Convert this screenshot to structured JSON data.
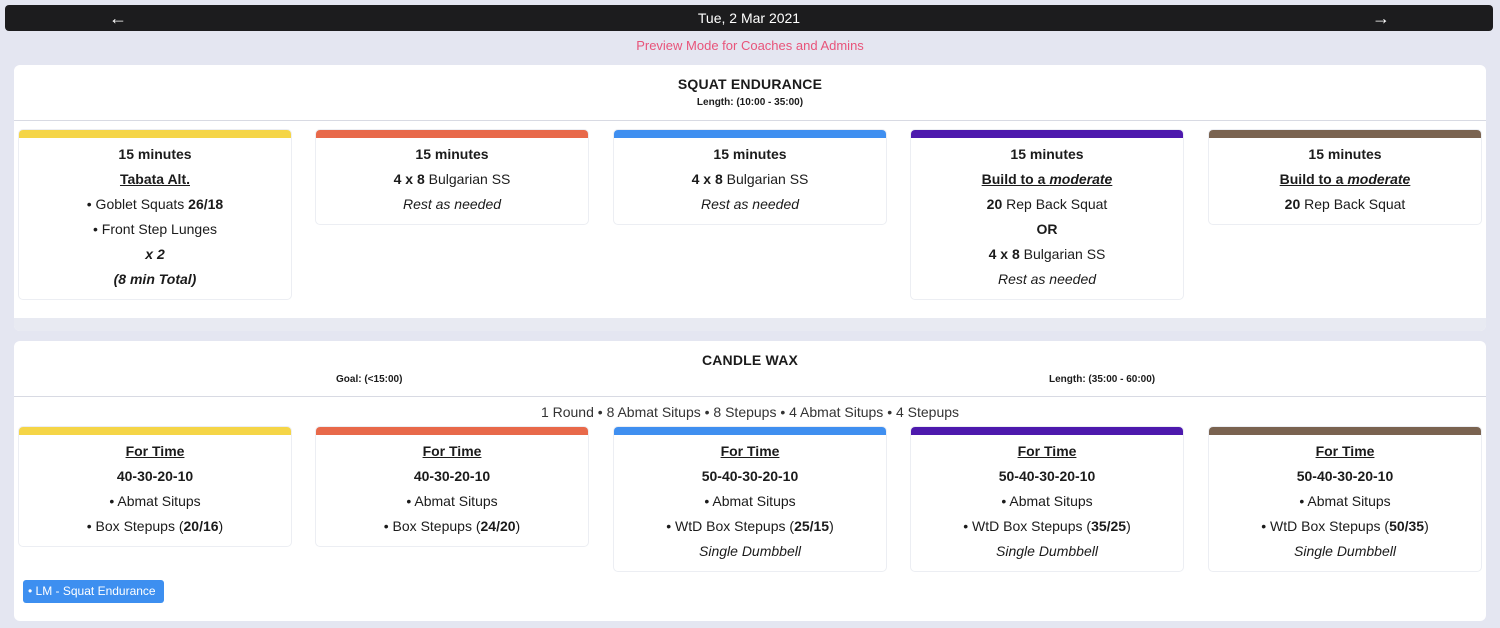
{
  "header": {
    "date": "Tue, 2 Mar 2021",
    "prev_icon": "←",
    "next_icon": "→"
  },
  "preview_notice": "Preview Mode for Coaches and Admins",
  "colors": {
    "accent": "#e8547a",
    "tracks": [
      "#f5d547",
      "#e8694a",
      "#3f8ff0",
      "#4d19ad",
      "#7a6350"
    ],
    "tag": "#3d8ff0"
  },
  "sections": [
    {
      "title": "SQUAT ENDURANCE",
      "length": "Length: (10:00 - 35:00)",
      "cards": [
        [
          [
            {
              "t": "15 minutes",
              "b": true
            }
          ],
          [
            {
              "t": "Tabata Alt.",
              "b": true,
              "u": true
            }
          ],
          [
            {
              "t": "• Goblet Squats "
            },
            {
              "t": "26/18",
              "b": true
            }
          ],
          [
            {
              "t": "• Front Step Lunges"
            }
          ],
          [
            {
              "t": "x 2",
              "b": true,
              "i": true
            }
          ],
          [
            {
              "t": "(8 min Total)",
              "b": true,
              "i": true
            }
          ]
        ],
        [
          [
            {
              "t": "15 minutes",
              "b": true
            }
          ],
          [
            {
              "t": "4 x 8",
              "b": true
            },
            {
              "t": " Bulgarian SS"
            }
          ],
          [
            {
              "t": "Rest as needed",
              "i": true
            }
          ]
        ],
        [
          [
            {
              "t": "15 minutes",
              "b": true
            }
          ],
          [
            {
              "t": "4 x 8",
              "b": true
            },
            {
              "t": " Bulgarian SS"
            }
          ],
          [
            {
              "t": "Rest as needed",
              "i": true
            }
          ]
        ],
        [
          [
            {
              "t": "15 minutes",
              "b": true
            }
          ],
          [
            {
              "t": "Build to a ",
              "b": true,
              "u": true
            },
            {
              "t": "moderate",
              "b": true,
              "u": true,
              "i": true
            },
            {
              "t": " ",
              "b": true,
              "u": true
            }
          ],
          [
            {
              "t": "20",
              "b": true
            },
            {
              "t": " Rep Back Squat"
            }
          ],
          [
            {
              "t": "OR",
              "b": true
            }
          ],
          [
            {
              "t": "4 x 8",
              "b": true
            },
            {
              "t": " Bulgarian SS"
            }
          ],
          [
            {
              "t": "Rest as needed",
              "i": true
            }
          ]
        ],
        [
          [
            {
              "t": "15 minutes",
              "b": true
            }
          ],
          [
            {
              "t": "Build to a ",
              "b": true,
              "u": true
            },
            {
              "t": "moderate",
              "b": true,
              "u": true,
              "i": true
            },
            {
              "t": " ",
              "b": true,
              "u": true
            }
          ],
          [
            {
              "t": "20",
              "b": true
            },
            {
              "t": " Rep Back Squat"
            }
          ]
        ]
      ]
    },
    {
      "title": "CANDLE WAX",
      "goal": "Goal: (<15:00)",
      "length": "Length: (35:00 - 60:00)",
      "description": "1 Round • 8 Abmat Situps • 8 Stepups • 4 Abmat Situps • 4 Stepups",
      "cards": [
        [
          [
            {
              "t": "For Time",
              "b": true,
              "u": true
            }
          ],
          [
            {
              "t": "40-30-20-10",
              "b": true
            }
          ],
          [
            {
              "t": "• Abmat Situps"
            }
          ],
          [
            {
              "t": "• Box Stepups ("
            },
            {
              "t": "20/16",
              "b": true
            },
            {
              "t": ")"
            }
          ]
        ],
        [
          [
            {
              "t": "For Time",
              "b": true,
              "u": true
            }
          ],
          [
            {
              "t": "40-30-20-10",
              "b": true
            }
          ],
          [
            {
              "t": "• Abmat Situps"
            }
          ],
          [
            {
              "t": "• Box Stepups ("
            },
            {
              "t": "24/20",
              "b": true
            },
            {
              "t": ")"
            }
          ]
        ],
        [
          [
            {
              "t": "For Time",
              "b": true,
              "u": true
            }
          ],
          [
            {
              "t": "50-40-30-20-10",
              "b": true
            }
          ],
          [
            {
              "t": "• Abmat Situps"
            }
          ],
          [
            {
              "t": "• WtD Box Stepups ("
            },
            {
              "t": "25/15",
              "b": true
            },
            {
              "t": ")"
            }
          ],
          [
            {
              "t": "Single Dumbbell",
              "i": true
            }
          ]
        ],
        [
          [
            {
              "t": "For Time",
              "b": true,
              "u": true
            }
          ],
          [
            {
              "t": "50-40-30-20-10",
              "b": true
            }
          ],
          [
            {
              "t": "• Abmat Situps"
            }
          ],
          [
            {
              "t": "• WtD Box Stepups ("
            },
            {
              "t": "35/25",
              "b": true
            },
            {
              "t": ")"
            }
          ],
          [
            {
              "t": "Single Dumbbell",
              "i": true
            }
          ]
        ],
        [
          [
            {
              "t": "For Time",
              "b": true,
              "u": true
            }
          ],
          [
            {
              "t": "50-40-30-20-10",
              "b": true
            }
          ],
          [
            {
              "t": "• Abmat Situps"
            }
          ],
          [
            {
              "t": "• WtD Box Stepups ("
            },
            {
              "t": "50/35",
              "b": true
            },
            {
              "t": ")"
            }
          ],
          [
            {
              "t": "Single Dumbbell",
              "i": true
            }
          ]
        ]
      ]
    }
  ],
  "tag": "• LM - Squat Endurance"
}
